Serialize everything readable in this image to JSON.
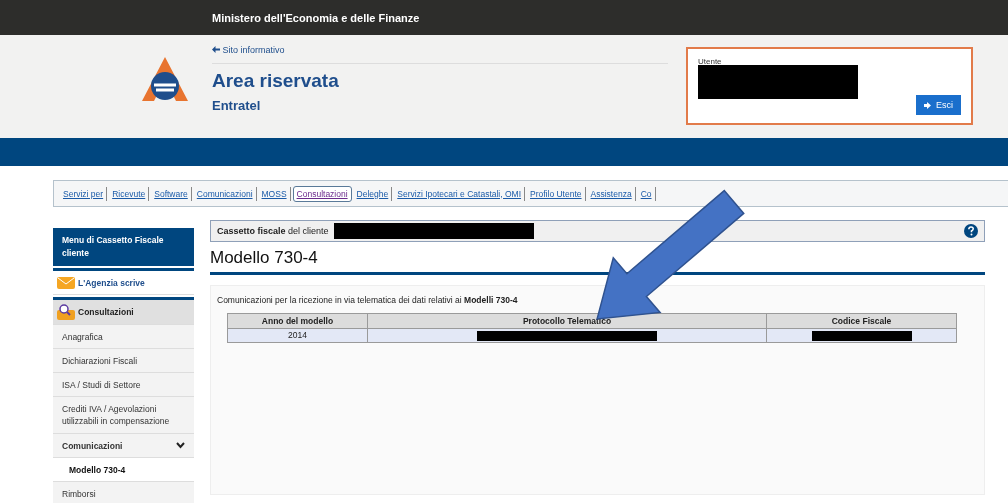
{
  "top_bar": {
    "title": "Ministero dell'Economia e delle Finanze"
  },
  "header": {
    "back_link": "Sito informativo",
    "title": "Area riservata",
    "subtitle": "Entratel",
    "user": {
      "label": "Utente",
      "redacted": true
    },
    "logout_button": "Esci"
  },
  "nav_tabs": [
    {
      "label": "Servizi per",
      "selected": false
    },
    {
      "label": "Ricevute",
      "selected": false
    },
    {
      "label": "Software",
      "selected": false
    },
    {
      "label": "Comunicazioni",
      "selected": false
    },
    {
      "label": "MOSS",
      "selected": false
    },
    {
      "label": "Consultazioni",
      "selected": true
    },
    {
      "label": "Deleghe",
      "selected": false
    },
    {
      "label": "Servizi Ipotecari e Catastali, OMI",
      "selected": false
    },
    {
      "label": "Profilo Utente",
      "selected": false
    },
    {
      "label": "Assistenza",
      "selected": false
    },
    {
      "label": "Co",
      "selected": false
    }
  ],
  "sidebar": {
    "title": "Menu di Cassetto Fiscale cliente",
    "items": [
      {
        "kind": "agency",
        "label": "L'Agenzia scrive",
        "selected": false
      },
      {
        "kind": "section",
        "label": "Consultazioni",
        "selected": false
      },
      {
        "kind": "item",
        "label": "Anagrafica",
        "selected": false
      },
      {
        "kind": "item",
        "label": "Dichiarazioni Fiscali",
        "selected": false
      },
      {
        "kind": "item",
        "label": "ISA / Studi di Settore",
        "selected": false
      },
      {
        "kind": "item",
        "label": "Crediti IVA / Agevolazioni utilizzabili in compensazione",
        "selected": false
      },
      {
        "kind": "group",
        "label": "Comunicazioni",
        "expanded": true,
        "selected": false
      },
      {
        "kind": "subitem",
        "label": "Modello 730-4",
        "selected": true
      },
      {
        "kind": "item",
        "label": "Rimborsi",
        "selected": false
      }
    ]
  },
  "client_bar": {
    "text": "**Cassetto fiscale** del cliente",
    "client_redacted": true
  },
  "page_title": "Modello 730-4",
  "intro": "Comunicazioni per la ricezione in via telematica dei dati relativi ai **Modelli 730-4**",
  "table": {
    "columns": [
      "Anno del modello",
      "Protocollo Telematico",
      "Codice Fiscale"
    ],
    "rows": [
      [
        {
          "text": "2014"
        },
        {
          "redacted": true
        },
        {
          "redacted": true
        }
      ]
    ]
  },
  "annotation": {
    "kind": "arrow"
  }
}
